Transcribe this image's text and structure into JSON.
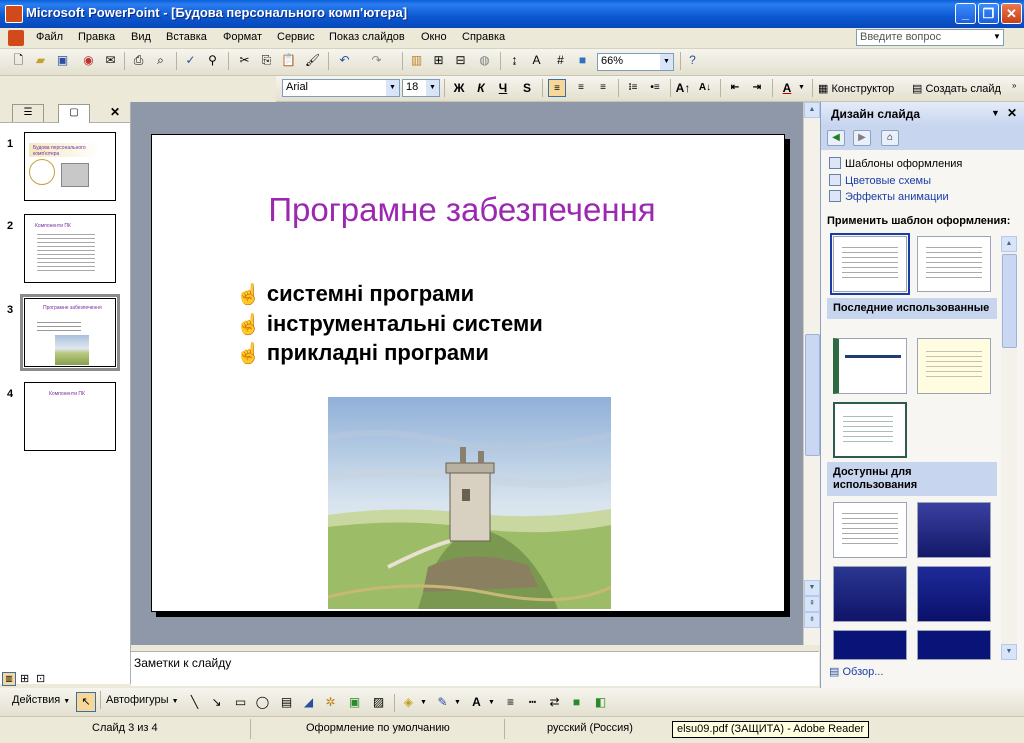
{
  "window": {
    "title": "Microsoft PowerPoint - [Будова персонального комп'ютера]"
  },
  "menu": {
    "items": [
      "Файл",
      "Правка",
      "Вид",
      "Вставка",
      "Формат",
      "Сервис",
      "Показ слайдов",
      "Окно",
      "Справка"
    ],
    "ask_placeholder": "Введите вопрос"
  },
  "toolbar": {
    "zoom": "66%"
  },
  "format_toolbar": {
    "font": "Arial",
    "size": "18",
    "bold": "Ж",
    "italic": "К",
    "underline": "Ч",
    "shadow": "S",
    "designer": "Конструктор",
    "new_slide": "Создать слайд"
  },
  "outline": {
    "slides": [
      {
        "num": "1",
        "title": "Будова персонального комп'ютера"
      },
      {
        "num": "2",
        "title": "Компоненти ПК"
      },
      {
        "num": "3",
        "title": "Програмне забезпечення"
      },
      {
        "num": "4",
        "title": "Компоненти ПК"
      }
    ]
  },
  "slide": {
    "title": "Програмне забезпечення",
    "bullets": [
      "системні програми",
      "інструментальні системи",
      "прикладні програми"
    ]
  },
  "notes": {
    "placeholder": "Заметки к слайду"
  },
  "taskpane": {
    "title": "Дизайн слайда",
    "links": [
      "Шаблоны оформления",
      "Цветовые схемы",
      "Эффекты анимации"
    ],
    "apply_label": "Применить шаблон оформления:",
    "section_recent": "Последние использованные",
    "section_available": "Доступны для использования",
    "browse": "Обзор..."
  },
  "drawing": {
    "actions": "Действия",
    "autoshapes": "Автофигуры"
  },
  "status": {
    "slide": "Слайд 3 из 4",
    "design": "Оформление по умолчанию",
    "language": "русский (Россия)",
    "tooltip": "elsu09.pdf (ЗАЩИТА) - Adobe Reader"
  },
  "colors": {
    "title_purple": "#9C27B0",
    "xp_blue": "#0B57D0"
  }
}
